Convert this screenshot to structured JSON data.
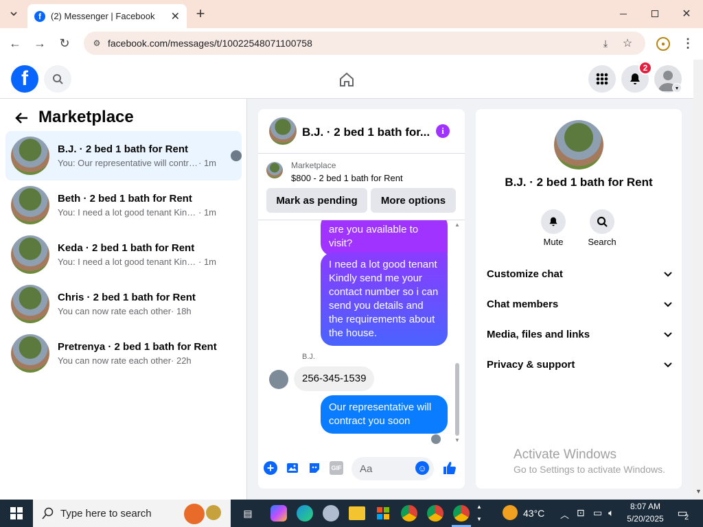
{
  "browser": {
    "tab_title": "(2) Messenger | Facebook",
    "url": "facebook.com/messages/t/10022548071100758"
  },
  "header": {
    "notification_count": "2"
  },
  "left": {
    "title": "Marketplace",
    "conversations": [
      {
        "name": "B.J. · 2 bed 1 bath for Rent",
        "snippet": "You: Our representative will contra...",
        "time": "· 1m"
      },
      {
        "name": "Beth · 2 bed 1 bath for Rent",
        "snippet": "You: I need a lot good tenant Kindly s...",
        "time": "· 1m"
      },
      {
        "name": "Keda · 2 bed 1 bath for Rent",
        "snippet": "You: I need a lot good tenant Kindly s...",
        "time": "· 1m"
      },
      {
        "name": "Chris · 2 bed 1 bath for Rent",
        "snippet": "You can now rate each other",
        "time": "· 18h"
      },
      {
        "name": "Pretrenya · 2 bed 1 bath for Rent",
        "snippet": "You can now rate each other",
        "time": "· 22h"
      }
    ]
  },
  "chat": {
    "title": "B.J. · 2 bed 1 bath for...",
    "marketplace_label": "Marketplace",
    "listing": "$800 - 2 bed 1 bath for Rent",
    "mark_pending": "Mark as pending",
    "more_options": "More options",
    "msg1": "are you available to visit?",
    "msg2": "I need a lot good tenant Kindly send me your contact number so i can send you details and the requirements about the house.",
    "sender": "B.J.",
    "msg3": "256-345-1539",
    "msg4": "Our representative will contract you soon",
    "input_placeholder": "Aa"
  },
  "right": {
    "title": "B.J. · 2 bed 1 bath for Rent",
    "mute": "Mute",
    "search": "Search",
    "sections": [
      "Customize chat",
      "Chat members",
      "Media, files and links",
      "Privacy & support"
    ]
  },
  "watermark": {
    "title": "Activate Windows",
    "sub": "Go to Settings to activate Windows."
  },
  "taskbar": {
    "search_placeholder": "Type here to search",
    "weather": "43°C",
    "time": "8:07 AM",
    "date": "5/20/2025",
    "notif": "2"
  },
  "colors": {
    "accent": "#0866ff",
    "bubble_top": "#a033ff",
    "bubble_bottom": "#0a7cff"
  }
}
